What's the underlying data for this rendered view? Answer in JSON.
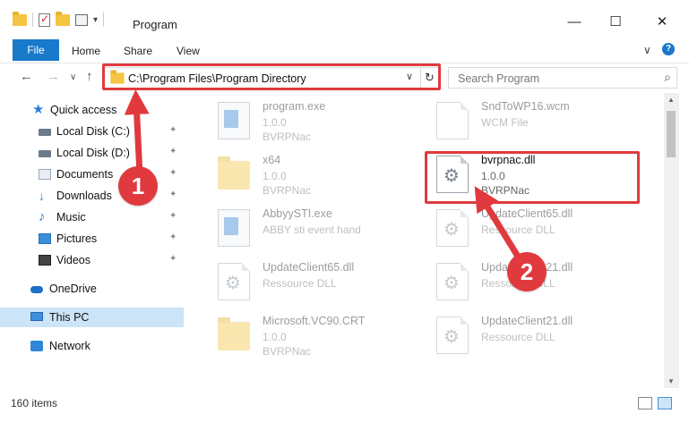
{
  "window": {
    "title": "Program",
    "minimize": "—",
    "maximize": "☐",
    "close": "✕"
  },
  "ribbon": {
    "tabs": [
      "File",
      "Home",
      "Share",
      "View"
    ],
    "expand": "∨",
    "help": "?"
  },
  "nav": {
    "back": "←",
    "forward": "→",
    "recent": "∨",
    "up": "↑"
  },
  "address": {
    "path": "C:\\Program Files\\Program Directory",
    "chevron": "∨",
    "refresh": "↻"
  },
  "search": {
    "placeholder": "Search Program",
    "icon": "⌕"
  },
  "sidebar": {
    "items": [
      {
        "label": "Quick access",
        "icon": "star-icon"
      },
      {
        "label": "Local Disk (C:)",
        "icon": "drive-icon",
        "pinned": true
      },
      {
        "label": "Local Disk (D:)",
        "icon": "drive-icon",
        "pinned": true
      },
      {
        "label": "Documents",
        "icon": "documents-icon",
        "pinned": true
      },
      {
        "label": "Downloads",
        "icon": "download-icon",
        "pinned": true
      },
      {
        "label": "Music",
        "icon": "music-icon",
        "pinned": true
      },
      {
        "label": "Pictures",
        "icon": "pictures-icon",
        "pinned": true
      },
      {
        "label": "Videos",
        "icon": "videos-icon",
        "pinned": true
      },
      {
        "label": "OneDrive",
        "icon": "cloud-icon"
      },
      {
        "label": "This PC",
        "icon": "computer-icon",
        "selected": true
      },
      {
        "label": "Network",
        "icon": "network-icon"
      }
    ],
    "pin_glyph": "📌"
  },
  "files": [
    {
      "name": "program.exe",
      "line2": "1.0.0",
      "line3": "BVRPNac",
      "icon": "exe-icon"
    },
    {
      "name": "SndToWP16.wcm",
      "line2": "WCM File",
      "line3": "",
      "icon": "document-icon"
    },
    {
      "name": "x64",
      "line2": "1.0.0",
      "line3": "BVRPNac",
      "icon": "folder-icon"
    },
    {
      "name": "bvrpnac.dll",
      "line2": "1.0.0",
      "line3": "BVRPNac",
      "icon": "dll-gear-icon"
    },
    {
      "name": "AbbyySTI.exe",
      "line2": "ABBY sti event hand",
      "line3": "",
      "icon": "exe-icon"
    },
    {
      "name": "UpdateClient65.dll",
      "line2": "Ressource DLL",
      "line3": "",
      "icon": "dll-gear-icon"
    },
    {
      "name": "UpdateClient65.dll",
      "line2": "Ressource DLL",
      "line3": "",
      "icon": "dll-gear-icon"
    },
    {
      "name": "UpdateClient21.dll",
      "line2": "Ressource DLL",
      "line3": "",
      "icon": "dll-gear-icon"
    },
    {
      "name": "Microsoft.VC90.CRT",
      "line2": "1.0.0",
      "line3": "BVRPNac",
      "icon": "folder-icon"
    },
    {
      "name": "UpdateClient21.dll",
      "line2": "Ressource DLL",
      "line3": "",
      "icon": "dll-gear-icon"
    }
  ],
  "status": {
    "item_count": "160 items"
  },
  "annotations": {
    "badge1": "1",
    "badge2": "2",
    "color": "#e03a3e"
  },
  "colors": {
    "accent": "#1979ca",
    "selected": "#cce4f7"
  }
}
